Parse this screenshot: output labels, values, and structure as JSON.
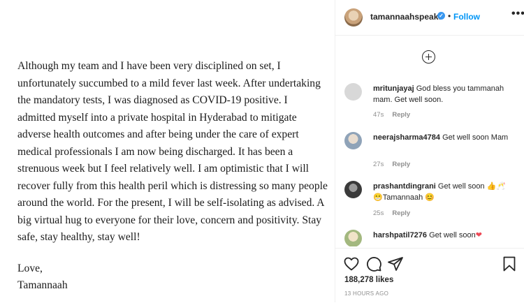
{
  "post": {
    "letter_paragraph": "Although my team and I have been very disciplined on set, I unfortunately succumbed to a mild fever last week. After undertaking the mandatory tests, I was diagnosed as COVID-19 positive. I admitted myself into a private hospital in Hyderabad to mitigate adverse health outcomes and after being under the care of expert medical professionals I am now being discharged. It has been a strenuous week but I feel relatively well. I am optimistic that I will recover fully from this health peril which is distressing so many people around the world. For the present, I will be self-isolating as advised. A big virtual hug to everyone for their love, concern and positivity. Stay safe, stay healthy, stay well!",
    "sign_off": "Love,",
    "signature": "Tamannaah"
  },
  "header": {
    "username": "tamannaahspeaks",
    "verified_mark": "✓",
    "separator": "•",
    "follow_label": "Follow",
    "more_label": "•••"
  },
  "comments": [
    {
      "user": "mritunjayaj",
      "text": "God bless you tammanah mam. Get well soon.",
      "time": "47s",
      "reply": "Reply",
      "avatar_color": "#d8d8d8"
    },
    {
      "user": "neerajsharma4784",
      "text": "Get well soon Mam",
      "time": "27s",
      "reply": "Reply",
      "avatar_color": "#c9b8a6"
    },
    {
      "user": "prashantdingrani",
      "text": "Get well soon 👍🥂 😁Tamannaah 😊",
      "time": "25s",
      "reply": "Reply",
      "avatar_color": "#555555"
    },
    {
      "user": "harshpatil7276",
      "text": "Get well soon",
      "heart": "❤",
      "avatar_color": "#b8c9a0"
    }
  ],
  "actions": {
    "icons": [
      "heart-icon",
      "comment-icon",
      "share-icon",
      "bookmark-icon"
    ],
    "likes": "188,278 likes",
    "timestamp": "13 HOURS AGO"
  }
}
